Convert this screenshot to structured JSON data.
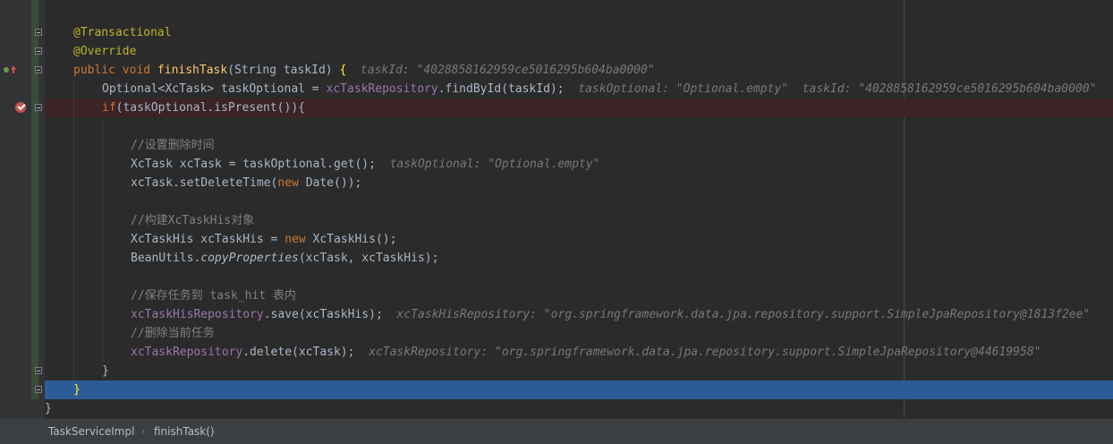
{
  "code_lines": [
    {
      "segs": [
        {
          "c": "ann",
          "t": "@Transactional"
        }
      ]
    },
    {
      "segs": [
        {
          "c": "ann",
          "t": "@Override"
        }
      ]
    },
    {
      "segs": [
        {
          "c": "kw",
          "t": "public void "
        },
        {
          "c": "fn",
          "t": "finishTask"
        },
        {
          "c": "",
          "t": "(String taskId) "
        },
        {
          "c": "brace-hl",
          "t": "{"
        },
        {
          "c": "hint",
          "t": "  taskId: \"4028858162959ce5016295b604ba0000\""
        }
      ]
    },
    {
      "segs": [
        {
          "c": "",
          "t": "Optional<XcTask> taskOptional = "
        },
        {
          "c": "field",
          "t": "xcTaskRepository"
        },
        {
          "c": "",
          "t": ".findById(taskId);"
        },
        {
          "c": "hint",
          "t": "  taskOptional: \"Optional.empty\"  taskId: \"4028858162959ce5016295b604ba0000\""
        }
      ]
    },
    {
      "segs": [
        {
          "c": "kw",
          "t": "if"
        },
        {
          "c": "",
          "t": "(taskOptional.isPresent()){"
        }
      ]
    },
    {
      "segs": []
    },
    {
      "segs": [
        {
          "c": "cmt",
          "t": "//设置删除时间"
        }
      ]
    },
    {
      "segs": [
        {
          "c": "",
          "t": "XcTask xcTask = taskOptional.get();"
        },
        {
          "c": "hint",
          "t": "  taskOptional: \"Optional.empty\""
        }
      ]
    },
    {
      "segs": [
        {
          "c": "",
          "t": "xcTask.setDeleteTime("
        },
        {
          "c": "kw",
          "t": "new "
        },
        {
          "c": "",
          "t": "Date());"
        }
      ]
    },
    {
      "segs": []
    },
    {
      "segs": [
        {
          "c": "cmt",
          "t": "//构建XcTaskHis对象"
        }
      ]
    },
    {
      "segs": [
        {
          "c": "",
          "t": "XcTaskHis xcTaskHis = "
        },
        {
          "c": "kw",
          "t": "new "
        },
        {
          "c": "",
          "t": "XcTaskHis();"
        }
      ]
    },
    {
      "segs": [
        {
          "c": "",
          "t": "BeanUtils."
        },
        {
          "c": "ital",
          "t": "copyProperties"
        },
        {
          "c": "",
          "t": "(xcTask, xcTaskHis);"
        }
      ]
    },
    {
      "segs": []
    },
    {
      "segs": [
        {
          "c": "cmt",
          "t": "//保存任务到 task_hit 表内"
        }
      ]
    },
    {
      "segs": [
        {
          "c": "field",
          "t": "xcTaskHisRepository"
        },
        {
          "c": "",
          "t": ".save(xcTaskHis);"
        },
        {
          "c": "hint",
          "t": "  xcTaskHisRepository: \"org.springframework.data.jpa.repository.support.SimpleJpaRepository@1813f2ee\""
        }
      ]
    },
    {
      "segs": [
        {
          "c": "cmt",
          "t": "//删除当前任务"
        }
      ]
    },
    {
      "segs": [
        {
          "c": "field",
          "t": "xcTaskRepository"
        },
        {
          "c": "",
          "t": ".delete(xcTask);"
        },
        {
          "c": "hint",
          "t": "  xcTaskRepository: \"org.springframework.data.jpa.repository.support.SimpleJpaRepository@44619958\""
        }
      ]
    },
    {
      "segs": [
        {
          "c": "",
          "t": "}"
        }
      ]
    },
    {
      "segs": [
        {
          "c": "brace-hl",
          "t": "}"
        }
      ]
    },
    {
      "segs": [
        {
          "c": "",
          "t": "}"
        }
      ]
    }
  ],
  "breadcrumb": {
    "class_name": "TaskServiceImpl",
    "separator": "›",
    "method_name": "finishTask()"
  },
  "colors": {
    "background": "#2b2b2b",
    "keyword": "#cc7832",
    "annotation": "#bbb529",
    "method": "#ffc66d",
    "field": "#9876aa",
    "comment": "#808080",
    "inline_hint": "#787878",
    "breakpoint_line": "#3b2326",
    "execution_line": "#2d5b96"
  },
  "icons": {
    "breakpoint": "breakpoint-verified-icon",
    "override": "implements-method-icon"
  }
}
